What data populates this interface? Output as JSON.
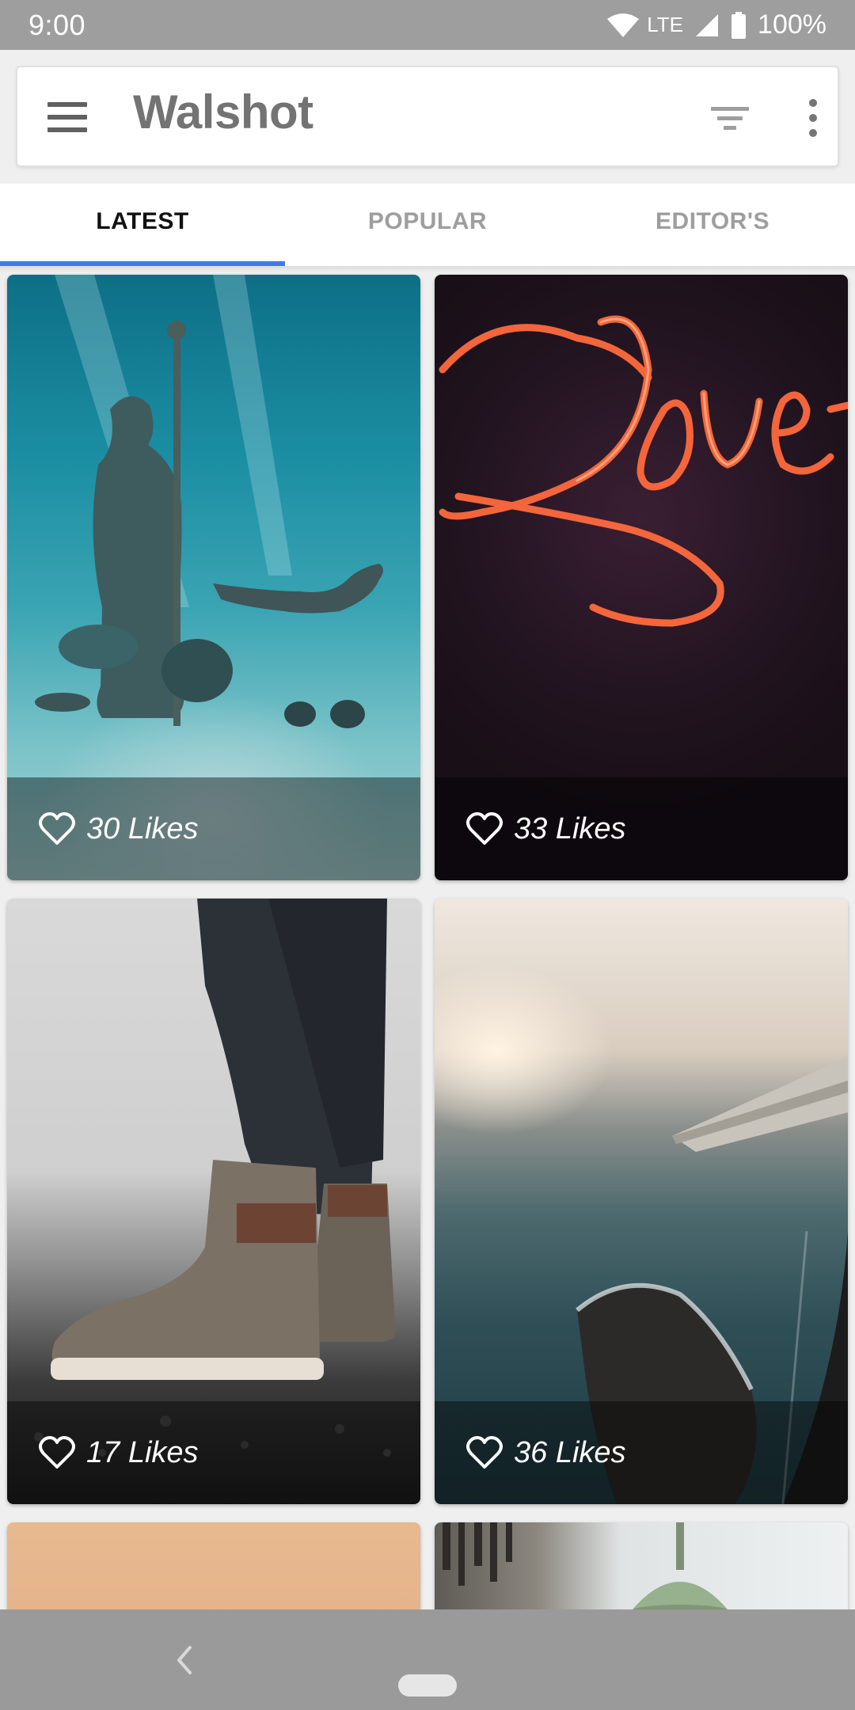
{
  "status_bar": {
    "time": "9:00",
    "network": "LTE",
    "battery": "100%"
  },
  "app_bar": {
    "title": "Walshot",
    "menu_icon": "hamburger-menu-icon",
    "filter_icon": "filter-icon",
    "more_icon": "more-vert-icon"
  },
  "tabs": [
    {
      "label": "LATEST",
      "active": true
    },
    {
      "label": "POPULAR",
      "active": false
    },
    {
      "label": "EDITOR'S",
      "active": false
    }
  ],
  "accent_color": "#3d7be7",
  "photos": [
    {
      "likes": "30 Likes",
      "subject": "underwater statue and diver"
    },
    {
      "likes": "33 Likes",
      "subject": "neon love sign"
    },
    {
      "likes": "17 Likes",
      "subject": "boots on gravel"
    },
    {
      "likes": "36 Likes",
      "subject": "airplane window coastline"
    }
  ],
  "nav_bar": {
    "back_icon": "back-icon",
    "home_icon": "home-pill-icon"
  }
}
